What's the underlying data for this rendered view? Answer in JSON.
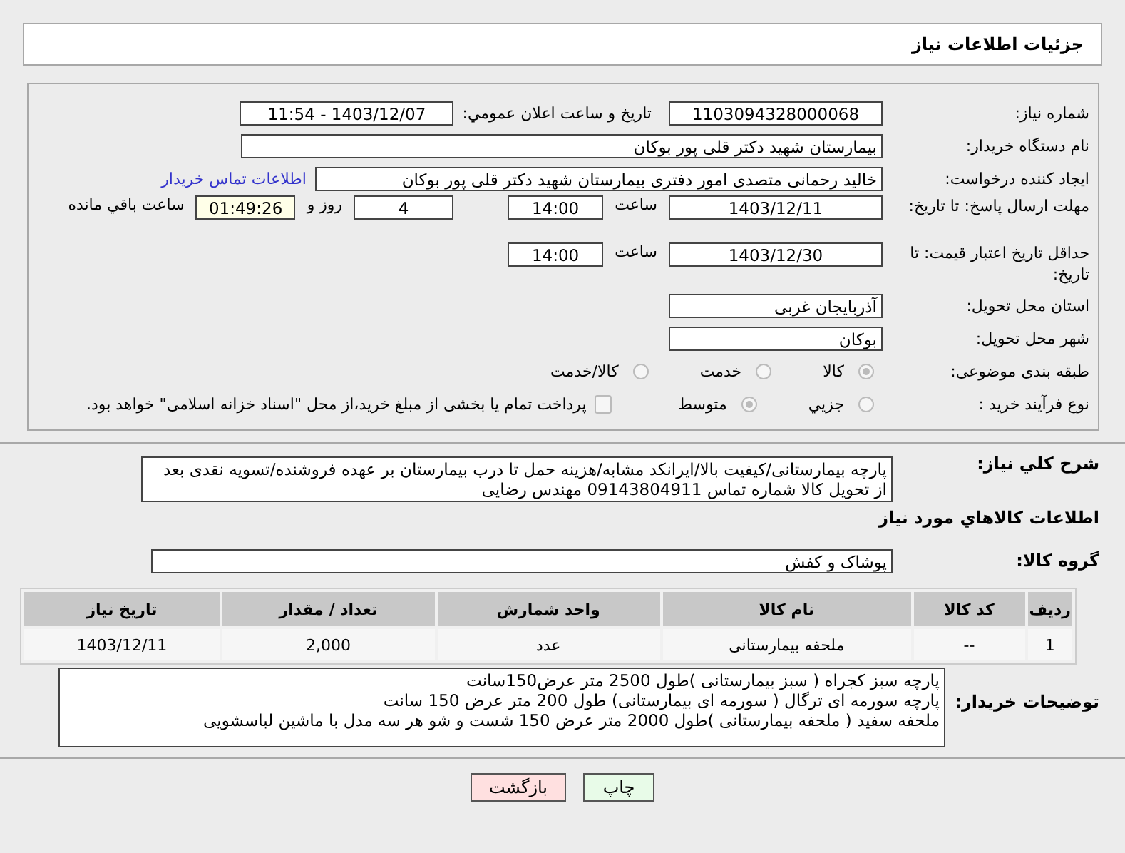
{
  "header": {
    "title": "جزئیات اطلاعات نیاز"
  },
  "form": {
    "need_number": {
      "label": "شماره نیاز:",
      "value": "1103094328000068"
    },
    "announce": {
      "label": "تاریخ و ساعت اعلان عمومي:",
      "value": "1403/12/07 - 11:54"
    },
    "buyer": {
      "label": "نام دستگاه خریدار:",
      "value": "بیمارستان شهید دکتر قلی پور بوکان"
    },
    "creator": {
      "label": "ایجاد کننده درخواست:",
      "value": "خالید رحمانی متصدی امور دفتری بیمارستان شهید دکتر قلی پور بوکان",
      "link": "اطلاعات تماس خریدار"
    },
    "deadline": {
      "label": "مهلت ارسال پاسخ: تا تاریخ:",
      "date": "1403/12/11",
      "time_label": "ساعت",
      "time": "14:00",
      "days": "4",
      "days_label": "روز و",
      "remaining": "01:49:26",
      "remaining_label": "ساعت باقي مانده"
    },
    "validity": {
      "label": "حداقل تاریخ اعتبار قیمت: تا تاریخ:",
      "date": "1403/12/30",
      "time_label": "ساعت",
      "time": "14:00"
    },
    "province": {
      "label": "استان محل تحویل:",
      "value": "آذربایجان غربی"
    },
    "city": {
      "label": "شهر محل تحویل:",
      "value": "بوکان"
    },
    "category": {
      "label": "طبقه بندی موضوعی:",
      "options": [
        {
          "label": "کالا",
          "selected": true
        },
        {
          "label": "خدمت",
          "selected": false
        },
        {
          "label": "کالا/خدمت",
          "selected": false
        }
      ]
    },
    "purchase_type": {
      "label": "نوع فرآیند خرید :",
      "options": [
        {
          "label": "جزیي",
          "selected": false
        },
        {
          "label": "متوسط",
          "selected": true
        }
      ],
      "payment": {
        "checked": false,
        "text": "پرداخت تمام یا بخشی از مبلغ خرید،از محل \"اسناد خزانه اسلامی\" خواهد بود."
      }
    }
  },
  "details": {
    "summary": {
      "label": "شرح کلي نياز:",
      "value": "پارچه بیمارستانی/کیفیت بالا/ایرانکد مشابه/هزینه حمل تا درب بیمارستان بر عهده فروشنده/تسویه نقدی بعد از تحویل کالا شماره تماس 09143804911 مهندس رضایی"
    },
    "goods_heading": "اطلاعات کالاهاي مورد نياز",
    "group": {
      "label": "گروه کالا:",
      "value": "پوشاک و کفش"
    },
    "table": {
      "columns": [
        "ردیف",
        "کد کالا",
        "نام کالا",
        "واحد شمارش",
        "تعداد / مقدار",
        "تاریخ نیاز"
      ],
      "rows": [
        [
          "1",
          "--",
          "ملحفه بیمارستانی",
          "عدد",
          "2,000",
          "1403/12/11"
        ]
      ]
    },
    "notes": {
      "label": "توضیحات خریدار:",
      "lines": [
        "پارچه سبز کجراه ( سبز بیمارستانی )طول  2500 متر عرض150سانت",
        "پارچه سورمه ای ترگال ( سورمه ای بیمارستانی) طول  200 متر  عرض 150 سانت",
        "ملحفه سفید ( ملحفه بیمارستانی )طول  2000 متر عرض 150 شست و شو هر سه مدل با ماشین لباسشویی"
      ]
    }
  },
  "buttons": [
    {
      "kind": "print",
      "label": "چاپ"
    },
    {
      "kind": "back",
      "label": "بازگشت"
    }
  ]
}
